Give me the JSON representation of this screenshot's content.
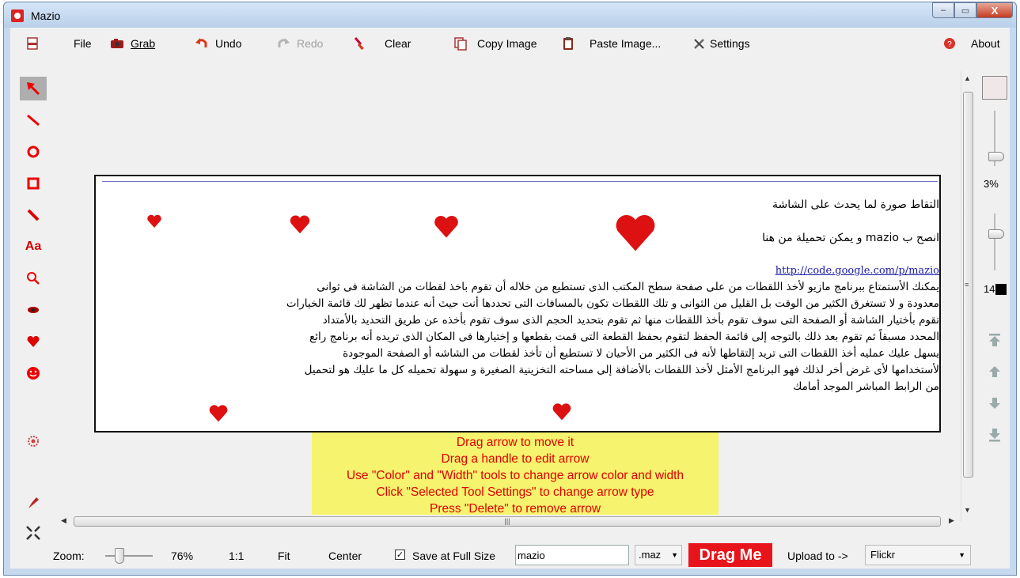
{
  "window": {
    "title": "Mazio"
  },
  "caption": {
    "min": "–",
    "max": "▭",
    "close": "X"
  },
  "toolbar": {
    "file": "File",
    "grab": "Grab",
    "undo": "Undo",
    "redo": "Redo",
    "clear": "Clear",
    "copy_image": "Copy Image",
    "paste_image": "Paste Image...",
    "settings": "Settings",
    "about": "About"
  },
  "left_tools": [
    "arrow",
    "line",
    "ellipse",
    "rectangle",
    "pencil",
    "text",
    "magnifier",
    "blur",
    "heart",
    "smiley",
    "settings",
    "highlighter",
    "shrink"
  ],
  "left_tools_text": {
    "text_tool": "Aa"
  },
  "content": {
    "heading": "التقاط صورة لما يحدث على الشاشة",
    "advice": "انصح ب mazio و يمكن تحميلة من هنا",
    "link": "http://code.google.com/p/mazio",
    "lines": [
      "يمكنك الأستمتاع ببرنامج مازيو لأخذ اللقطات من على صفحة سطح المكتب  الذى تستطيع من خلاله أن تقوم باخذ لقطات من الشاشة فى ثوانى",
      "معدودة و لا تستغرق الكثير من الوقت بل القليل من الثوانى و تلك اللقطات تكون بالمسافات التى تحددها أنت حيث أنه عندما تظهر لك قائمة الخيارات",
      "تقوم بأختيار الشاشة أو الصفحة التى سوف تقوم بأخذ اللقطات منها ثم تقوم بتحديد الحجم الذى سوف تقوم بأخذه عن طريق التحديد بالأمتداد",
      "المحدد مسبقاً ثم تقوم بعد ذلك بالتوجه إلى قائمة الحفظ لتقوم بحفظ القطعة التى قمت بقطعها و إختيارها فى المكان الذى تريده أنه برنامج رائع",
      "يسهل عليك عمليه أخذ اللقطات التى تريد إلتقاطها لأنه فى الكثير من الأحيان لا تستطيع أن تأخذ لقطات من الشاشه أو الصفحة الموجودة",
      "لأستخدامها لأى غرض أخر لذلك فهو البرنامج الأمثل لأخذ اللقطات بالأضافة إلى مساحته التخزينية الصغيرة و سهولة تحميله كل ما عليك هو لتحميل",
      "من الرابط المباشر الموجد أمامك"
    ]
  },
  "tooltip": [
    "Drag arrow to move it",
    "Drag a handle to edit arrow",
    "Use \"Color\" and \"Width\" tools to change arrow color and width",
    "Click \"Selected Tool Settings\" to change arrow type",
    "Press \"Delete\" to remove arrow"
  ],
  "right_panel": {
    "opacity": "3%",
    "width": "14",
    "scroll_h_mark": "|||",
    "vscroll_mark": "≡"
  },
  "status": {
    "zoom_label": "Zoom:",
    "zoom_value": "76%",
    "one_to_one": "1:1",
    "fit": "Fit",
    "center": "Center",
    "save_full": "Save at Full Size",
    "save_full_checked": true,
    "filename": "mazio",
    "extension": ".maz",
    "drag_me": "Drag Me",
    "upload_label": "Upload to ->",
    "upload_target": "Flickr"
  },
  "colors": {
    "accent_red": "#e00000",
    "tooltip_bg": "#f6f36e",
    "drag_me_bg": "#e8141b"
  }
}
